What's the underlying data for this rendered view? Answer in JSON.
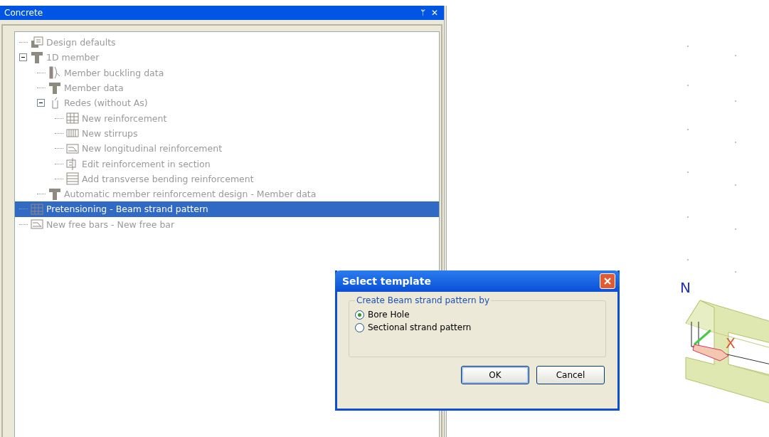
{
  "panel": {
    "title": "Concrete",
    "pin": "ᛘ",
    "close": "✕"
  },
  "tree": [
    {
      "label": "Design defaults",
      "selected": false
    },
    {
      "label": "1D member",
      "selected": false,
      "expanded": true,
      "children": [
        {
          "label": "Member buckling data",
          "selected": false
        },
        {
          "label": "Member data",
          "selected": false
        },
        {
          "label": "Redes (without As)",
          "selected": false,
          "expanded": true,
          "children": [
            {
              "label": "New reinforcement",
              "selected": false
            },
            {
              "label": "New stirrups",
              "selected": false
            },
            {
              "label": "New longitudinal reinforcement",
              "selected": false
            },
            {
              "label": "Edit reinforcement in section",
              "selected": false
            },
            {
              "label": "Add transverse bending reinforcement",
              "selected": false
            }
          ]
        },
        {
          "label": "Automatic member reinforcement design - Member data",
          "selected": false
        }
      ]
    },
    {
      "label": "Pretensioning - Beam strand pattern",
      "selected": true
    },
    {
      "label": "New free bars - New free bar",
      "selected": false
    }
  ],
  "viewport": {
    "axis_labels": [
      "N",
      "X"
    ]
  },
  "dialog": {
    "title": "Select template",
    "group": "Create Beam strand pattern by",
    "options": [
      {
        "label": "Bore Hole",
        "selected": true
      },
      {
        "label": "Sectional strand pattern",
        "selected": false
      }
    ],
    "buttons": [
      "OK",
      "Cancel"
    ]
  }
}
